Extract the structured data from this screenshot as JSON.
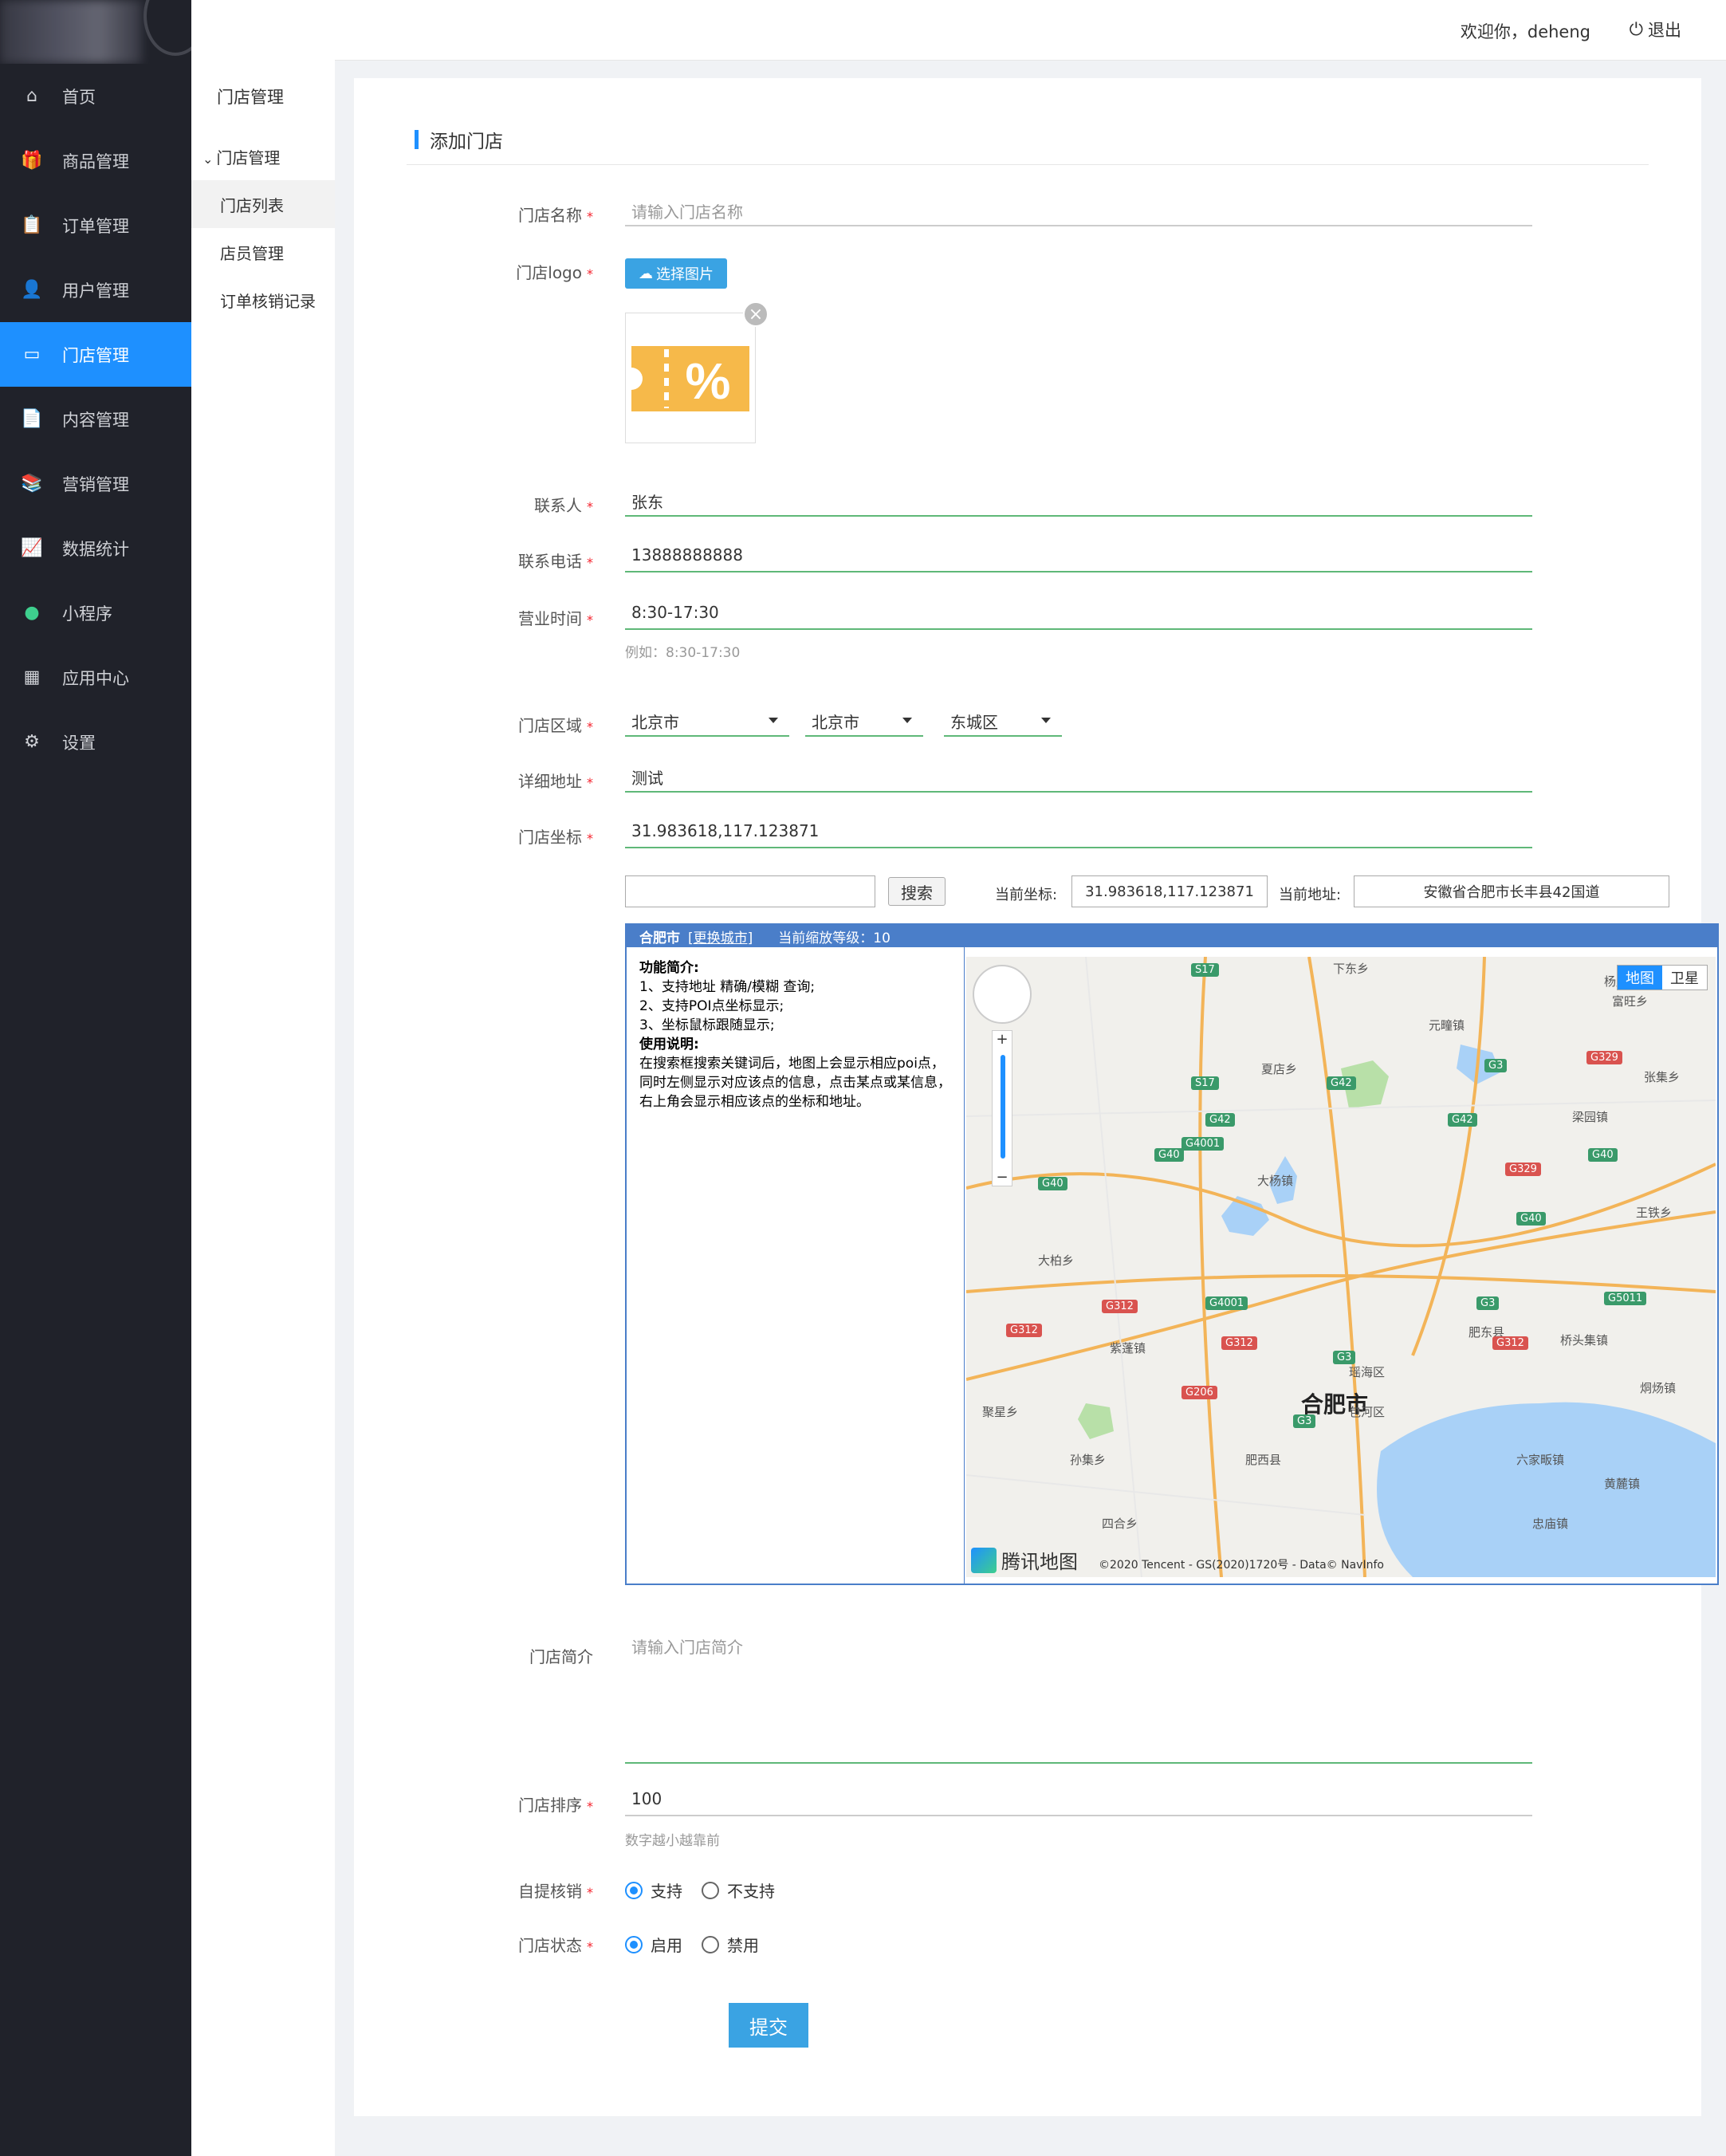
{
  "topbar": {
    "welcome": "欢迎你，deheng",
    "logout": "退出"
  },
  "sidebar": {
    "items": [
      {
        "label": "首页",
        "icon": "home-icon",
        "active": false
      },
      {
        "label": "商品管理",
        "icon": "gift-icon",
        "active": false
      },
      {
        "label": "订单管理",
        "icon": "clipboard-icon",
        "active": false
      },
      {
        "label": "用户管理",
        "icon": "user-icon",
        "active": false
      },
      {
        "label": "门店管理",
        "icon": "store-icon",
        "active": true
      },
      {
        "label": "内容管理",
        "icon": "document-icon",
        "active": false
      },
      {
        "label": "营销管理",
        "icon": "books-icon",
        "active": false
      },
      {
        "label": "数据统计",
        "icon": "line-chart-icon",
        "active": false
      },
      {
        "label": "小程序",
        "icon": "miniprogram-icon",
        "active": false
      },
      {
        "label": "应用中心",
        "icon": "apps-icon",
        "active": false
      },
      {
        "label": "设置",
        "icon": "gear-icon",
        "active": false
      }
    ]
  },
  "subnav": {
    "title": "门店管理",
    "group": "门店管理",
    "items": [
      {
        "label": "门店列表",
        "active": true
      },
      {
        "label": "店员管理",
        "active": false
      },
      {
        "label": "订单核销记录",
        "active": false
      }
    ]
  },
  "page": {
    "title": "添加门店"
  },
  "form": {
    "name_label": "门店名称",
    "name_placeholder": "请输入门店名称",
    "logo_label": "门店logo",
    "logo_button": "选择图片",
    "contact_label": "联系人",
    "contact_value": "张东",
    "phone_label": "联系电话",
    "phone_value": "13888888888",
    "hours_label": "营业时间",
    "hours_value": "8:30-17:30",
    "hours_hint": "例如：8:30-17:30",
    "region_label": "门店区域",
    "province": "北京市",
    "city": "北京市",
    "district": "东城区",
    "address_label": "详细地址",
    "address_value": "测试",
    "coord_label": "门店坐标",
    "coord_value": "31.983618,117.123871",
    "intro_label": "门店简介",
    "intro_placeholder": "请输入门店简介",
    "sort_label": "门店排序",
    "sort_value": "100",
    "sort_hint": "数字越小越靠前",
    "pickup_label": "自提核销",
    "pickup_options": [
      "支持",
      "不支持"
    ],
    "status_label": "门店状态",
    "status_options": [
      "启用",
      "禁用"
    ],
    "submit": "提交"
  },
  "map": {
    "search_button": "搜索",
    "current_coord_label": "当前坐标:",
    "current_coord": "31.983618,117.123871",
    "current_address_label": "当前地址:",
    "current_address": "安徽省合肥市长丰县42国道",
    "city": "合肥市",
    "change_city": "[更换城市]",
    "zoom_text": "当前缩放等级：10",
    "info_title1": "功能简介:",
    "info_lines1": [
      "1、支持地址 精确/模糊 查询;",
      "2、支持POI点坐标显示;",
      "3、坐标鼠标跟随显示;"
    ],
    "info_title2": "使用说明:",
    "info_text2": "在搜索框搜索关键词后，地图上会显示相应poi点，同时左侧显示对应该点的信息，点击某点或某信息，右上角会显示相应该点的坐标和地址。",
    "toggle_map": "地图",
    "toggle_sat": "卫星",
    "logo_text": "腾讯地图",
    "copyright": "©2020 Tencent - GS(2020)1720号 - Data© NavInfo",
    "places": [
      {
        "name": "合肥市",
        "big": true
      },
      {
        "name": "瑶海区"
      },
      {
        "name": "包河区"
      },
      {
        "name": "肥东县"
      },
      {
        "name": "肥西县"
      },
      {
        "name": "下东乡"
      },
      {
        "name": "杨店乡"
      },
      {
        "name": "元疃镇"
      },
      {
        "name": "富旺乡"
      },
      {
        "name": "夏店乡"
      },
      {
        "name": "张集乡"
      },
      {
        "name": "梁园镇"
      },
      {
        "name": "大杨镇"
      },
      {
        "name": "王铁乡"
      },
      {
        "name": "大柏乡"
      },
      {
        "name": "紫蓬镇"
      },
      {
        "name": "桥头集镇"
      },
      {
        "name": "聚星乡"
      },
      {
        "name": "烔炀镇"
      },
      {
        "name": "孙集乡"
      },
      {
        "name": "六家畈镇"
      },
      {
        "name": "黄麓镇"
      },
      {
        "name": "四合乡"
      },
      {
        "name": "忠庙镇"
      }
    ],
    "shields": [
      "S17",
      "S17",
      "G42",
      "G42",
      "G42",
      "G3",
      "G329",
      "G40",
      "G4001",
      "G40",
      "G40",
      "G329",
      "G40",
      "G5011",
      "G4001",
      "G312",
      "G312",
      "G3",
      "G312",
      "G312",
      "G3",
      "G206",
      "G3"
    ]
  },
  "colors": {
    "accent": "#1e90ff",
    "sidebar_bg": "#20222a",
    "field_line": "#5fb878",
    "button": "#3aa3e3"
  }
}
